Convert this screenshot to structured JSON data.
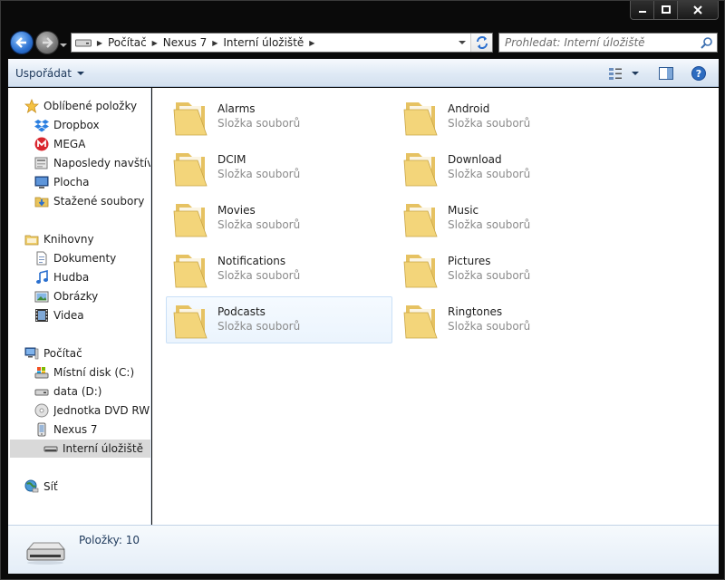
{
  "address": {
    "segments": [
      "Počítač",
      "Nexus 7",
      "Interní úložiště"
    ]
  },
  "search": {
    "placeholder": "Prohledat: Interní úložiště"
  },
  "toolbar": {
    "organize_label": "Uspořádat"
  },
  "navigation": {
    "favorites": {
      "label": "Oblíbené položky",
      "items": [
        "Dropbox",
        "MEGA",
        "Naposledy navštívené",
        "Plocha",
        "Stažené soubory"
      ]
    },
    "libraries": {
      "label": "Knihovny",
      "items": [
        "Dokumenty",
        "Hudba",
        "Obrázky",
        "Videa"
      ]
    },
    "computer": {
      "label": "Počítač",
      "items": [
        "Místní disk (C:)",
        "data (D:)",
        "Jednotka DVD RW (E:)",
        "Nexus 7",
        "Interní úložiště"
      ]
    },
    "network": {
      "label": "Síť"
    }
  },
  "folders": [
    {
      "name": "Alarms",
      "type": "Složka souborů"
    },
    {
      "name": "Android",
      "type": "Složka souborů"
    },
    {
      "name": "DCIM",
      "type": "Složka souborů"
    },
    {
      "name": "Download",
      "type": "Složka souborů"
    },
    {
      "name": "Movies",
      "type": "Složka souborů"
    },
    {
      "name": "Music",
      "type": "Složka souborů"
    },
    {
      "name": "Notifications",
      "type": "Složka souborů"
    },
    {
      "name": "Pictures",
      "type": "Složka souborů"
    },
    {
      "name": "Podcasts",
      "type": "Složka souborů"
    },
    {
      "name": "Ringtones",
      "type": "Složka souborů"
    }
  ],
  "details": {
    "item_count": "Položky: 10"
  },
  "colors": {
    "accent": "#1e395b",
    "folder": "#f3d57a",
    "selection": "#c9e0f7"
  }
}
